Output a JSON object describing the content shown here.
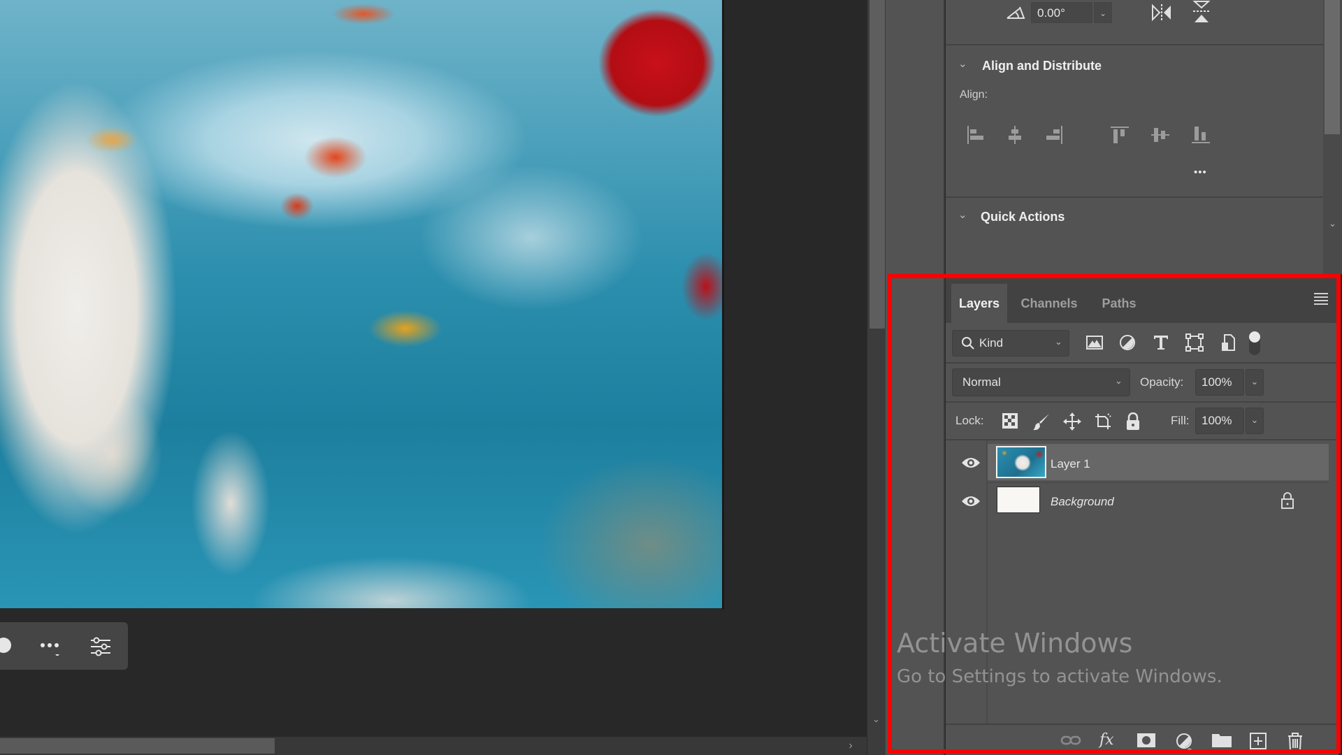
{
  "canvas": {
    "image_description": "underwater photo of a white dog with red and orange flower petals",
    "toolbar": {
      "more_icon": "more-horizontal-icon",
      "settings_icon": "sliders-icon"
    }
  },
  "properties": {
    "transform": {
      "angle_value": "0.00°",
      "angle_icon": "angle-icon",
      "flip_horizontal_icon": "flip-horizontal-icon",
      "flip_vertical_icon": "flip-vertical-icon"
    },
    "align_and_distribute": {
      "title": "Align and Distribute",
      "align_label": "Align:",
      "buttons": [
        "align-left-edges",
        "align-horizontal-centers",
        "align-right-edges",
        "align-top-edges",
        "align-vertical-centers",
        "align-bottom-edges"
      ],
      "more_label": "•••"
    },
    "quick_actions": {
      "title": "Quick Actions"
    }
  },
  "layers_panel": {
    "tabs": [
      {
        "label": "Layers",
        "active": true
      },
      {
        "label": "Channels",
        "active": false
      },
      {
        "label": "Paths",
        "active": false
      }
    ],
    "filter": {
      "kind_label": "Kind"
    },
    "blend_mode": "Normal",
    "opacity_label": "Opacity:",
    "opacity_value": "100%",
    "lock_label": "Lock:",
    "fill_label": "Fill:",
    "fill_value": "100%",
    "layers": [
      {
        "name": "Layer 1",
        "visible": true,
        "selected": true,
        "locked": false
      },
      {
        "name": "Background",
        "visible": true,
        "selected": false,
        "locked": true
      }
    ],
    "footer_icons": [
      "link-layers",
      "layer-style-fx",
      "add-mask",
      "new-adjustment-layer",
      "new-group",
      "new-layer",
      "delete-layer"
    ]
  },
  "os_watermark": {
    "title": "Activate Windows",
    "subtitle": "Go to Settings to activate Windows."
  },
  "highlight": {
    "color": "#ff0000",
    "target": "layers-panel"
  }
}
